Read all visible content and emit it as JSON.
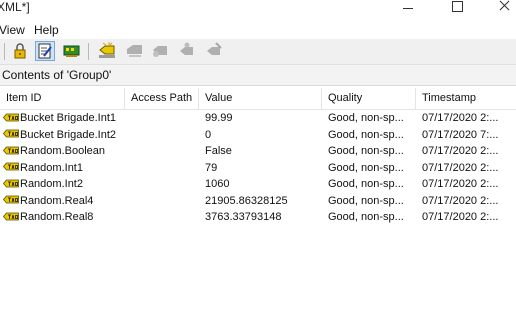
{
  "window": {
    "title": "XML*]"
  },
  "menu": {
    "items": [
      {
        "label": "View"
      },
      {
        "label": "Help"
      }
    ]
  },
  "toolbar": {
    "buttons": [
      {
        "icon": "lock-icon",
        "enabled": true
      },
      {
        "icon": "edit-document-icon",
        "enabled": true,
        "pressed": true
      },
      {
        "icon": "network-card-icon",
        "enabled": true
      },
      {
        "icon": "add-tag-icon",
        "enabled": true
      },
      {
        "icon": "read-icon",
        "enabled": false
      },
      {
        "icon": "write-icon",
        "enabled": false
      },
      {
        "icon": "refresh-icon",
        "enabled": false
      },
      {
        "icon": "async-write-icon",
        "enabled": false
      }
    ]
  },
  "group": {
    "header": "Contents of 'Group0'"
  },
  "table": {
    "columns": [
      "Item ID",
      "Access Path",
      "Value",
      "Quality",
      "Timestamp"
    ],
    "rows": [
      {
        "id": "Bucket Brigade.Int1",
        "access_path": "",
        "value": "99.99",
        "quality": "Good, non-sp...",
        "timestamp": "07/17/2020 2:..."
      },
      {
        "id": "Bucket Brigade.Int2",
        "access_path": "",
        "value": "0",
        "quality": "Good, non-sp...",
        "timestamp": "07/17/2020 7:..."
      },
      {
        "id": "Random.Boolean",
        "access_path": "",
        "value": "False",
        "quality": "Good, non-sp...",
        "timestamp": "07/17/2020 2:..."
      },
      {
        "id": "Random.Int1",
        "access_path": "",
        "value": "79",
        "quality": "Good, non-sp...",
        "timestamp": "07/17/2020 2:..."
      },
      {
        "id": "Random.Int2",
        "access_path": "",
        "value": "1060",
        "quality": "Good, non-sp...",
        "timestamp": "07/17/2020 2:..."
      },
      {
        "id": "Random.Real4",
        "access_path": "",
        "value": "21905.86328125",
        "quality": "Good, non-sp...",
        "timestamp": "07/17/2020 2:..."
      },
      {
        "id": "Random.Real8",
        "access_path": "",
        "value": "3763.33793148",
        "quality": "Good, non-sp...",
        "timestamp": "07/17/2020 2:..."
      }
    ]
  },
  "colors": {
    "toolbar_bg": "#f0f0f0",
    "pressed_bg": "#cce4f7",
    "tag_icon": "#e8c800"
  }
}
